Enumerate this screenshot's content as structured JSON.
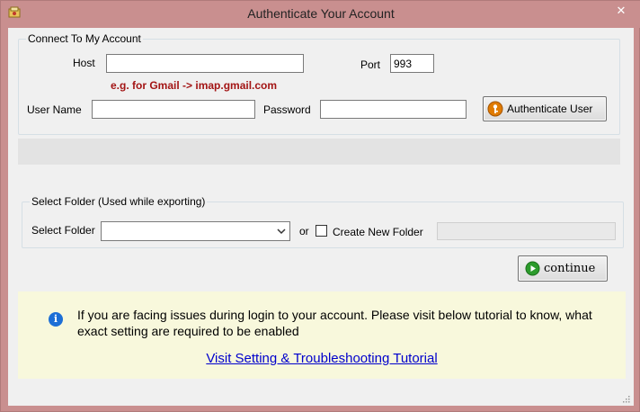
{
  "window": {
    "title": "Authenticate Your Account",
    "close_glyph": "✕",
    "app_icon": "app-icon"
  },
  "connect": {
    "legend": "Connect To My Account",
    "host_label": "Host",
    "host_value": "",
    "port_label": "Port",
    "port_value": "993",
    "hint": "e.g. for Gmail -> imap.gmail.com",
    "username_label": "User Name",
    "username_value": "",
    "password_label": "Password",
    "password_value": "",
    "authenticate_button": "Authenticate User",
    "authenticate_icon": "key-icon",
    "authenticate_icon_color": "#e07b00"
  },
  "folder": {
    "legend": "Select Folder (Used while exporting)",
    "select_label": "Select Folder",
    "select_value": "",
    "or_label": "or",
    "create_new_checked": false,
    "create_new_label": "Create New Folder",
    "new_folder_value": ""
  },
  "continue_button": {
    "label": "continue",
    "icon": "play-icon",
    "icon_color": "#2c9b2c"
  },
  "info": {
    "icon": "info-icon",
    "message": "If you are facing issues during login to your account. Please visit below tutorial to know, what exact setting are required to be enabled",
    "link_text": "Visit Setting & Troubleshooting Tutorial",
    "link_color": "#0000cc",
    "background": "#f8f8dc"
  },
  "theme": {
    "frame_color": "#c98f8f",
    "client_color": "#f0f0f0"
  }
}
